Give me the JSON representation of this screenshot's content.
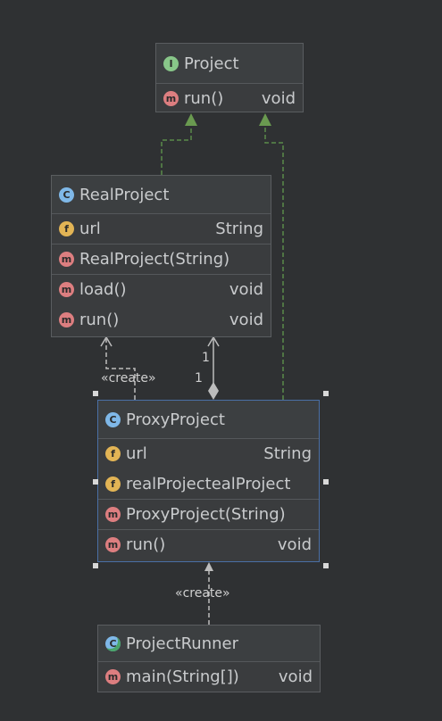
{
  "project": {
    "title": "Project",
    "method": {
      "name": "run()",
      "type": "void"
    }
  },
  "real_project": {
    "title": "RealProject",
    "field": {
      "name": "url",
      "type": "String"
    },
    "constructor": "RealProject(String)",
    "methods": [
      {
        "name": "load()",
        "type": "void"
      },
      {
        "name": "run()",
        "type": "void"
      }
    ]
  },
  "proxy_project": {
    "title": "ProxyProject",
    "fields": [
      {
        "name": "url",
        "type": "String"
      },
      {
        "name": "realProject",
        "type": "ealProject"
      }
    ],
    "constructor": "ProxyProject(String)",
    "method": {
      "name": "run()",
      "type": "void"
    }
  },
  "project_runner": {
    "title": "ProjectRunner",
    "method": {
      "name": "main(String[])",
      "type": "void"
    }
  },
  "labels": {
    "create_1": "«create»",
    "create_2": "«create»",
    "mult_top": "1",
    "mult_bottom": "1"
  },
  "colors": {
    "background": "#2f3133",
    "implements_arrow": "#5a8a4a",
    "dependency_arrow": "#bdbdbd",
    "selection": "#4a6fa5"
  }
}
